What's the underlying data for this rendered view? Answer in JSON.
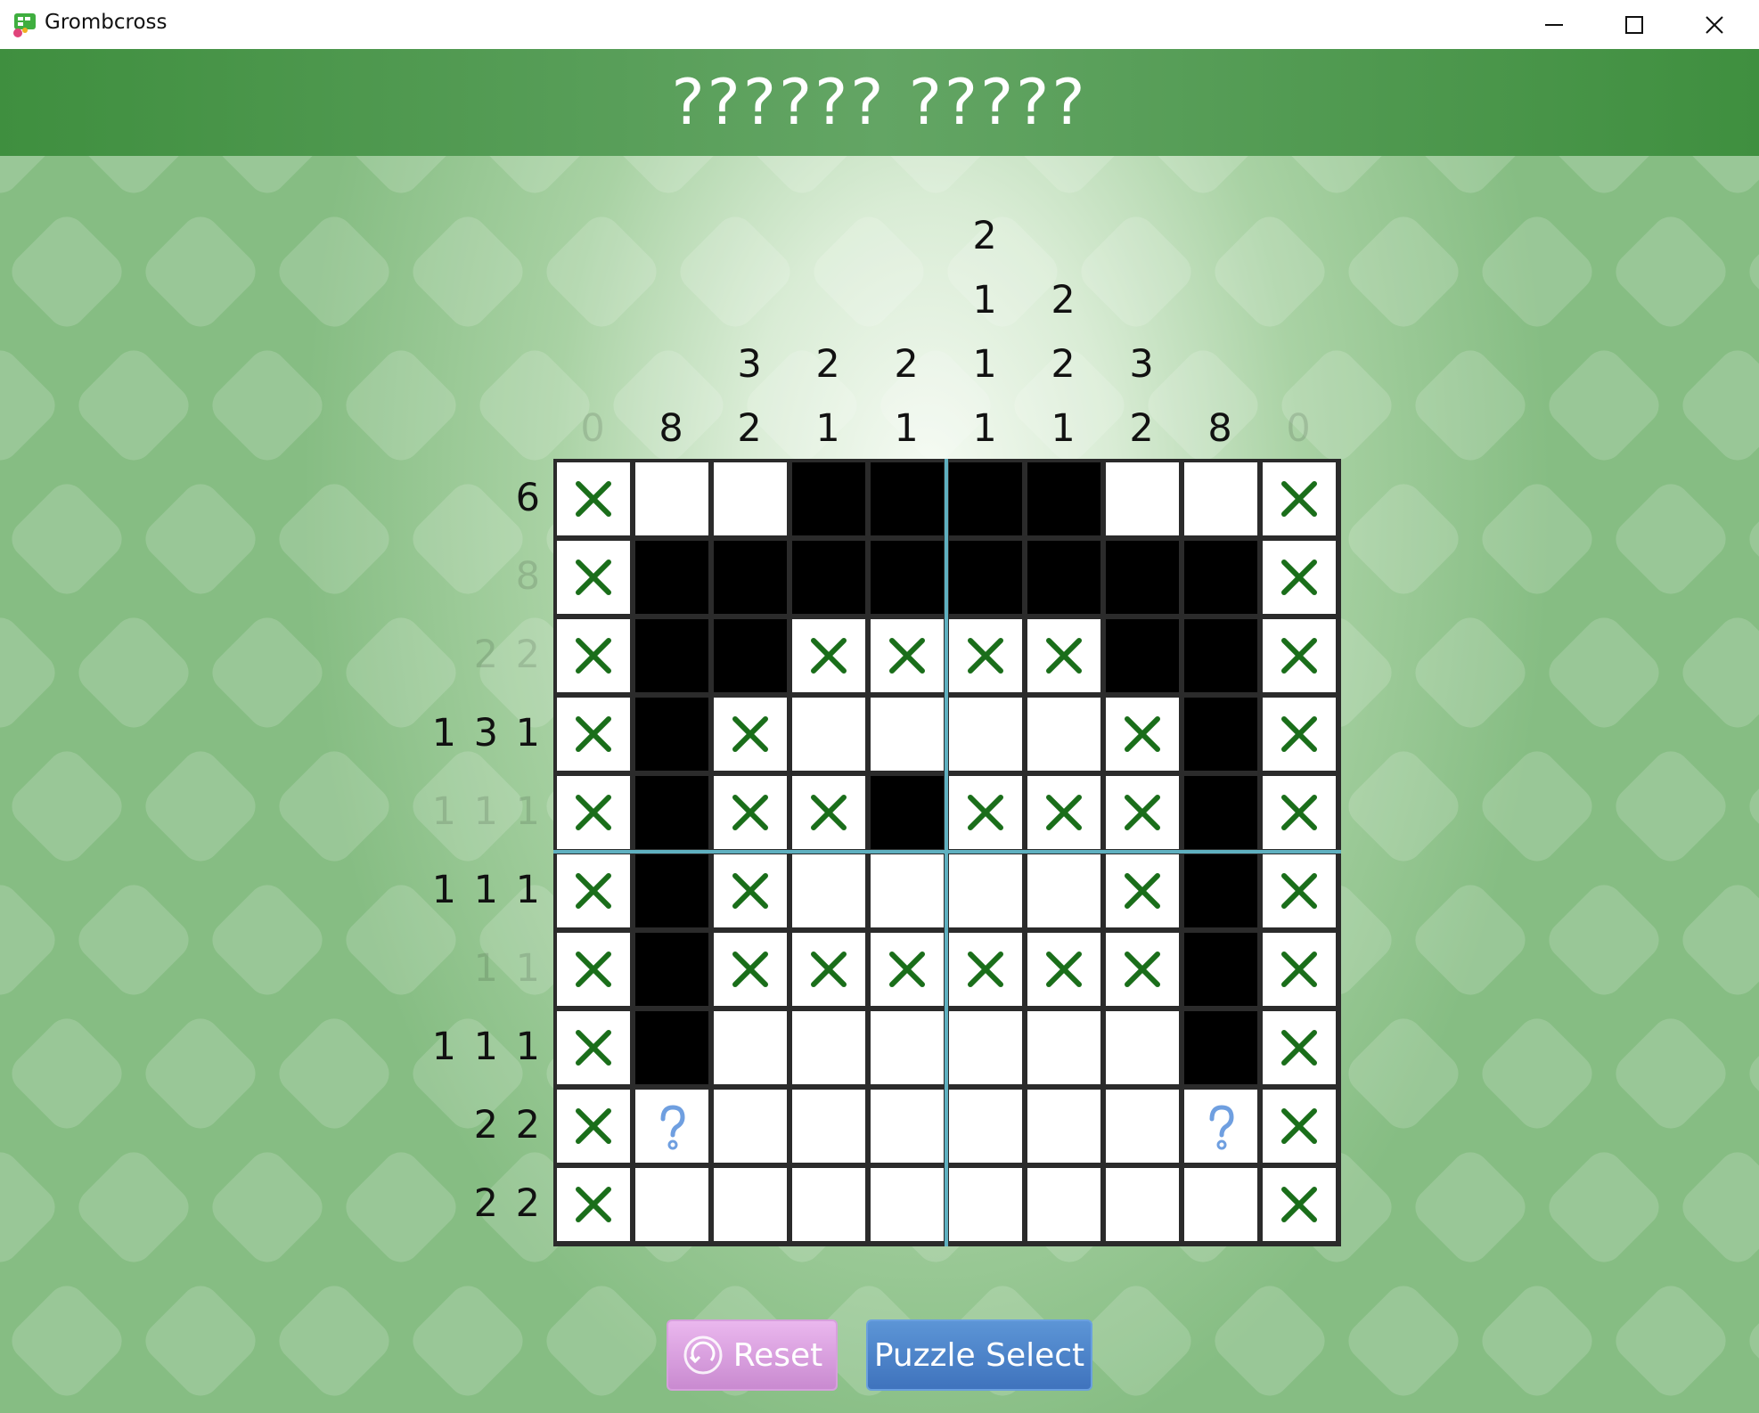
{
  "window": {
    "title": "Grombcross",
    "icon": "grombcross-app-icon",
    "controls": [
      "minimize-icon",
      "maximize-icon",
      "close-icon"
    ]
  },
  "header": {
    "title": "?????? ?????"
  },
  "puzzle": {
    "size": 10,
    "column_clues": [
      {
        "values": [
          "0"
        ],
        "done": true
      },
      {
        "values": [
          "8"
        ],
        "done": false
      },
      {
        "values": [
          "3",
          "2"
        ],
        "done": false
      },
      {
        "values": [
          "2",
          "1"
        ],
        "done": false
      },
      {
        "values": [
          "2",
          "1"
        ],
        "done": false
      },
      {
        "values": [
          "2",
          "1",
          "1",
          "1"
        ],
        "done": false
      },
      {
        "values": [
          "2",
          "2",
          "1"
        ],
        "done": false
      },
      {
        "values": [
          "3",
          "2"
        ],
        "done": false
      },
      {
        "values": [
          "8"
        ],
        "done": false
      },
      {
        "values": [
          "0"
        ],
        "done": true
      }
    ],
    "row_clues": [
      {
        "text": "6",
        "done": false
      },
      {
        "text": "8",
        "done": true
      },
      {
        "text": "2 2",
        "done": true
      },
      {
        "text": "1 3 1",
        "done": false
      },
      {
        "text": "1 1 1",
        "done": true
      },
      {
        "text": "1 1 1",
        "done": false
      },
      {
        "text": "1 1",
        "done": true
      },
      {
        "text": "1 1 1",
        "done": false
      },
      {
        "text": "2 2",
        "done": false
      },
      {
        "text": "2 2",
        "done": false
      }
    ],
    "cell_legend": {
      ".": "empty",
      "#": "filled",
      "x": "crossed",
      "?": "question-hint"
    },
    "grid": [
      "x..####..x",
      "x########x",
      "x##xxxx##x",
      "x#x....x#x",
      "x#xx#xxx#x",
      "x#x....x#x",
      "x#xxxxxx#x",
      "x#......#x",
      "x?......?x",
      "x........x"
    ],
    "colors": {
      "cross": "#1a6e1a",
      "question": "#6f9fe0",
      "separator": "#5fb0c0",
      "grid_line": "#2b2b2b"
    }
  },
  "buttons": {
    "reset_label": "Reset",
    "reset_icon": "reset-icon",
    "puzzle_select_label": "Puzzle Select"
  },
  "theme": {
    "header_color": "#3f8f3f",
    "reset_color": "#d79ddd",
    "puzzle_select_color": "#4a80c8"
  }
}
